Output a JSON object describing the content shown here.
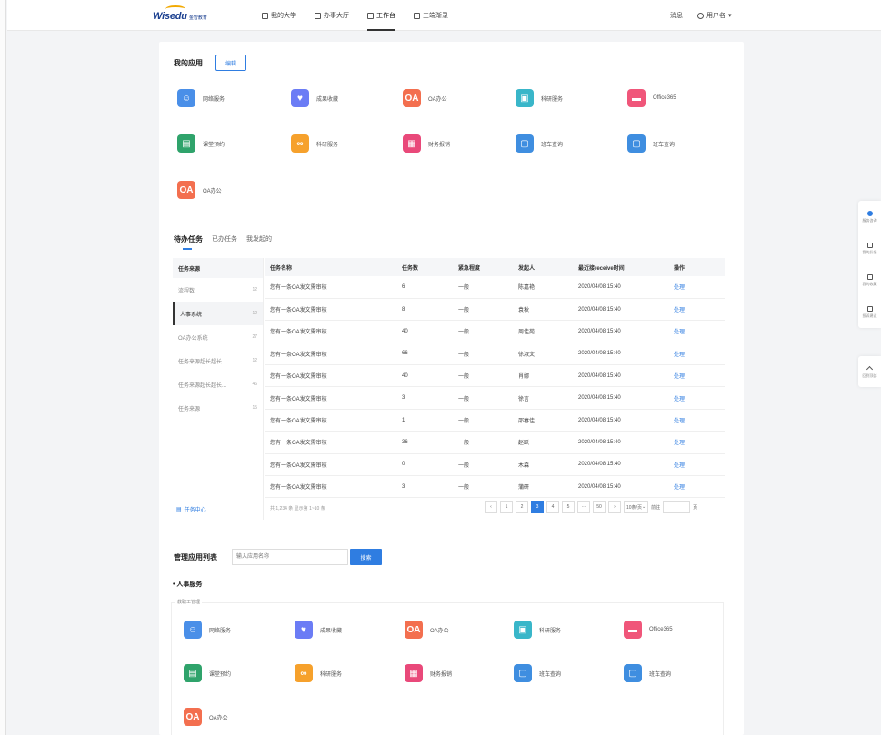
{
  "header": {
    "logo_main": "Wisedu",
    "logo_sub": "金智教育",
    "nav": [
      {
        "label": "我的大学",
        "icon": "university-icon"
      },
      {
        "label": "办事大厅",
        "icon": "service-hall-icon"
      },
      {
        "label": "工作台",
        "icon": "workbench-icon",
        "active": true
      },
      {
        "label": "三端渐录",
        "icon": "list-icon"
      }
    ],
    "messages": "消息",
    "username": "用户名"
  },
  "my_apps": {
    "title": "我的应用",
    "edit_label": "编辑",
    "apps": [
      {
        "label": "网络服务",
        "icon": "network-service-icon",
        "color": "#4a8fe8"
      },
      {
        "label": "成果收藏",
        "icon": "heart-icon",
        "color": "#6b7cf5"
      },
      {
        "label": "OA办公",
        "icon": "oa-icon",
        "color": "#f36f4f"
      },
      {
        "label": "科研服务",
        "icon": "research-icon",
        "color": "#39b6c9"
      },
      {
        "label": "Office365",
        "icon": "office-icon",
        "color": "#f0567a"
      },
      {
        "label": "课堂预约",
        "icon": "classroom-icon",
        "color": "#2fa36b"
      },
      {
        "label": "科研服务",
        "icon": "research-rings-icon",
        "color": "#f6a12c"
      },
      {
        "label": "财务报销",
        "icon": "finance-icon",
        "color": "#e9497a"
      },
      {
        "label": "班车查询",
        "icon": "bus-icon",
        "color": "#3f8ee0"
      },
      {
        "label": "班车查询",
        "icon": "bus-icon",
        "color": "#3f8ee0"
      },
      {
        "label": "OA办公",
        "icon": "oa-icon",
        "color": "#f36f4f"
      }
    ]
  },
  "tasks": {
    "tabs": [
      "待办任务",
      "已办任务",
      "我发起的"
    ],
    "sources_header": "任务来源",
    "sources": [
      {
        "label": "流程数",
        "count": "12"
      },
      {
        "label": "人事系统",
        "count": "12",
        "active": true
      },
      {
        "label": "OA办公系统",
        "count": "27"
      },
      {
        "label": "任务来源超长超长...",
        "count": "12"
      },
      {
        "label": "任务来源超长超长...",
        "count": "46"
      },
      {
        "label": "任务来源",
        "count": "15"
      }
    ],
    "center_label": "任务中心",
    "columns": [
      "任务名称",
      "任务数",
      "紧急程度",
      "发起人",
      "最近接receive时间",
      "操作"
    ],
    "rows": [
      [
        "您有一条OA发文需审核",
        "6",
        "一般",
        "陈嘉艳",
        "2020/04/08 15:40",
        "处理"
      ],
      [
        "您有一条OA发文需审核",
        "8",
        "一般",
        "袁秋",
        "2020/04/08 15:40",
        "处理"
      ],
      [
        "您有一条OA发文需审核",
        "40",
        "一般",
        "周佳苑",
        "2020/04/08 15:40",
        "处理"
      ],
      [
        "您有一条OA发文需审核",
        "66",
        "一般",
        "徐淑文",
        "2020/04/08 15:40",
        "处理"
      ],
      [
        "您有一条OA发文需审核",
        "40",
        "一般",
        "肖娜",
        "2020/04/08 15:40",
        "处理"
      ],
      [
        "您有一条OA发文需审核",
        "3",
        "一般",
        "徐言",
        "2020/04/08 15:40",
        "处理"
      ],
      [
        "您有一条OA发文需审核",
        "1",
        "一般",
        "邵春佳",
        "2020/04/08 15:40",
        "处理"
      ],
      [
        "您有一条OA发文需审核",
        "36",
        "一般",
        "赵跃",
        "2020/04/08 15:40",
        "处理"
      ],
      [
        "您有一条OA发文需审核",
        "0",
        "一般",
        "木森",
        "2020/04/08 15:40",
        "处理"
      ],
      [
        "您有一条OA发文需审核",
        "3",
        "一般",
        "蒲研",
        "2020/04/08 15:40",
        "处理"
      ]
    ],
    "pager": {
      "total_text": "共 1,234 条 显示第 1~10 条",
      "prev": "‹",
      "pages": [
        "1",
        "2",
        "3",
        "4",
        "5",
        "···",
        "50"
      ],
      "active_page": "3",
      "next": "›",
      "page_size": "10条/页",
      "goto_label": "前往",
      "page_unit": "页"
    }
  },
  "manage": {
    "title": "管理应用列表",
    "search_placeholder": "输入应用名称",
    "search_label": "搜索",
    "group_title": "• 人事服务",
    "sub_label": "教职工管理",
    "apps": [
      {
        "label": "网络服务",
        "icon": "network-service-icon",
        "color": "#4a8fe8"
      },
      {
        "label": "成果收藏",
        "icon": "heart-icon",
        "color": "#6b7cf5"
      },
      {
        "label": "OA办公",
        "icon": "oa-icon",
        "color": "#f36f4f"
      },
      {
        "label": "科研服务",
        "icon": "research-icon",
        "color": "#39b6c9"
      },
      {
        "label": "Office365",
        "icon": "office-icon",
        "color": "#f0567a"
      },
      {
        "label": "课堂预约",
        "icon": "classroom-icon",
        "color": "#2fa36b"
      },
      {
        "label": "科研服务",
        "icon": "research-rings-icon",
        "color": "#f6a12c"
      },
      {
        "label": "财务报销",
        "icon": "finance-icon",
        "color": "#e9497a"
      },
      {
        "label": "班车查询",
        "icon": "bus-icon",
        "color": "#3f8ee0"
      },
      {
        "label": "班车查询",
        "icon": "bus-icon",
        "color": "#3f8ee0"
      },
      {
        "label": "OA办公",
        "icon": "oa-icon",
        "color": "#f36f4f"
      }
    ]
  },
  "side_tools": {
    "items": [
      "服务咨询",
      "我的反馈",
      "我的收藏",
      "投诉建议"
    ],
    "back_top": "回到顶部"
  },
  "colors": {
    "accent": "#2f7de1"
  }
}
